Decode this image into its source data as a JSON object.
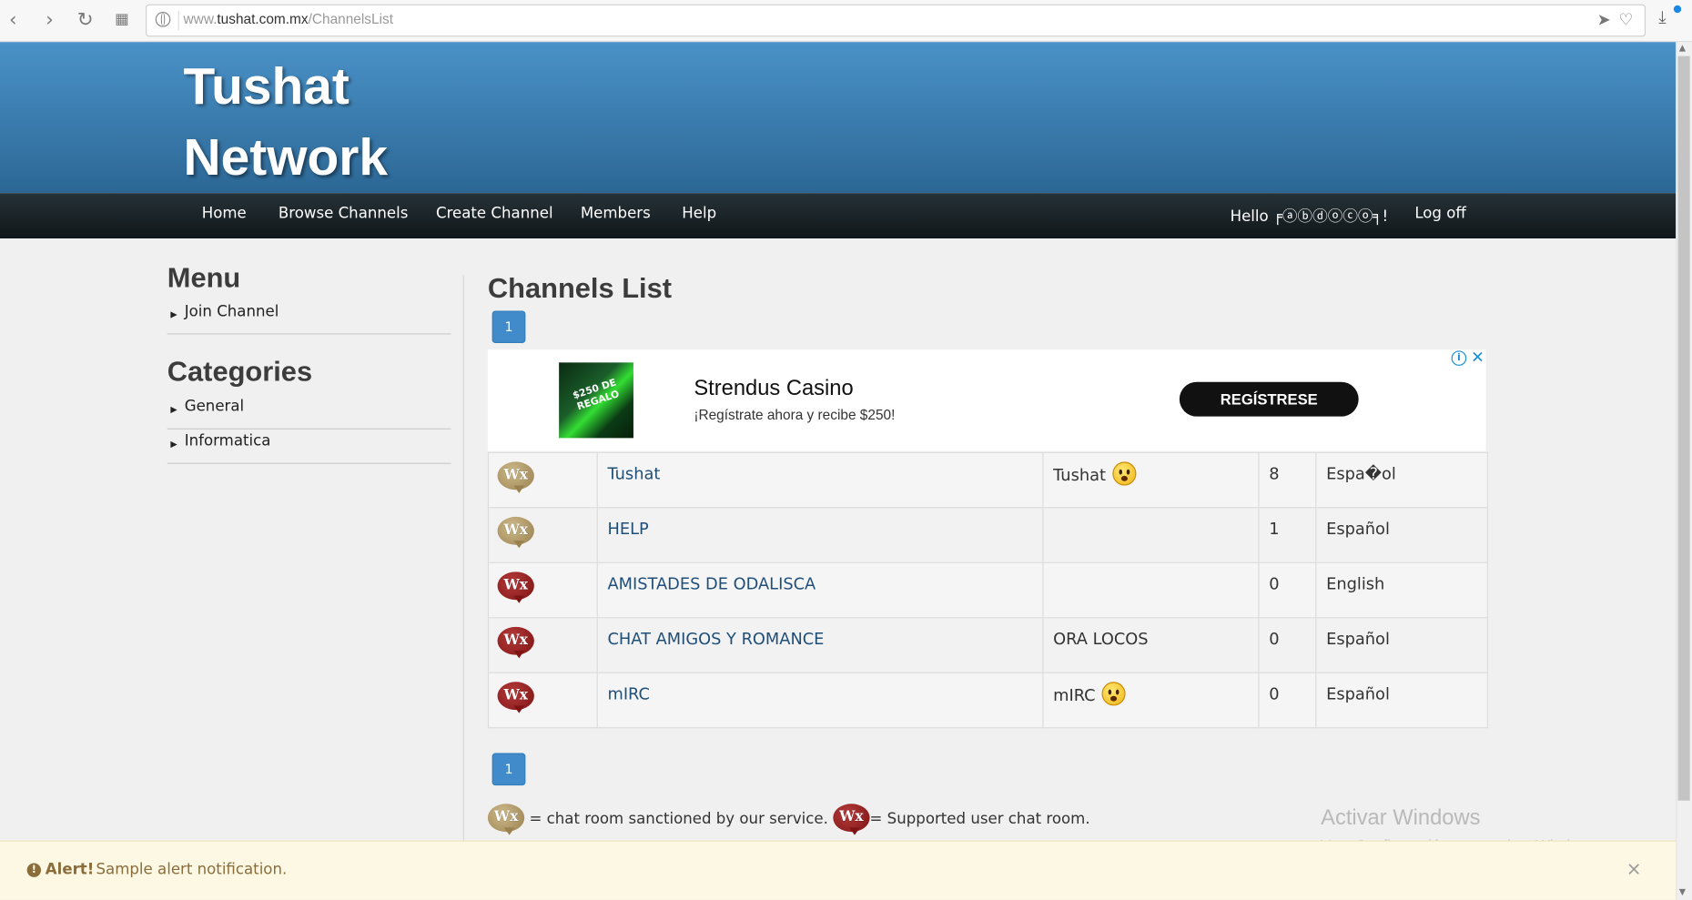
{
  "browser": {
    "url_prefix": "www.",
    "url_domain": "tushat.com.mx",
    "url_path": "/ChannelsList"
  },
  "site": {
    "title_line1": "Tushat",
    "title_line2": "Network"
  },
  "nav": {
    "home": "Home",
    "browse": "Browse Channels",
    "create": "Create Channel",
    "members": "Members",
    "help": "Help",
    "hello": "Hello ╒ⓐⓑⓓⓞⓒⓞ╕!",
    "logoff": "Log off"
  },
  "sidebar": {
    "menu_title": "Menu",
    "menu_items": [
      "Join Channel"
    ],
    "categories_title": "Categories",
    "categories": [
      "General",
      "Informatica"
    ]
  },
  "main": {
    "title": "Channels List",
    "page_number": "1"
  },
  "ad": {
    "image_text": "$250 DE REGALO",
    "name": "Strendus Casino",
    "description": "¡Regístrate ahora y recibe $250!",
    "cta": "REGÍSTRESE",
    "info": "i",
    "close": "✕"
  },
  "channels": [
    {
      "type": "sanctioned",
      "badge": "Wx",
      "name": "Tushat",
      "owner": "Tushat",
      "emoji": true,
      "users": "8",
      "language": "Espa�ol"
    },
    {
      "type": "sanctioned",
      "badge": "Wx",
      "name": "HELP",
      "owner": "",
      "emoji": false,
      "users": "1",
      "language": "Español"
    },
    {
      "type": "user",
      "badge": "Wx",
      "name": "AMISTADES DE ODALISCA",
      "owner": "",
      "emoji": false,
      "users": "0",
      "language": "English"
    },
    {
      "type": "user",
      "badge": "Wx",
      "name": "CHAT AMIGOS Y ROMANCE",
      "owner": "ORA LOCOS",
      "emoji": false,
      "users": "0",
      "language": "Español"
    },
    {
      "type": "user",
      "badge": "Wx",
      "name": "mIRC",
      "owner": "mIRC",
      "emoji": true,
      "users": "0",
      "language": "Español"
    }
  ],
  "legend": {
    "sanctioned_text": "= chat room sanctioned by our service.",
    "user_text": "= Supported user chat room."
  },
  "watermark": {
    "line1": "Activar Windows",
    "line2": "Ve a Configuración para activar Windows."
  },
  "alert": {
    "icon": "!",
    "title": "Alert!",
    "message": "Sample alert notification.",
    "close": "×"
  },
  "colors": {
    "header_top": "#4a92c8",
    "header_bottom": "#2c6795",
    "navbar": "#1a2226",
    "pager": "#428bca",
    "link": "#1f4e79",
    "alert_bg": "#fcf8e3",
    "alert_text": "#8a6d3b"
  },
  "icons": {
    "back": "chevron-left-icon",
    "forward": "chevron-right-icon",
    "reload": "reload-icon",
    "grid": "grid-icon",
    "globe": "globe-icon",
    "send": "send-icon",
    "favorite": "heart-icon",
    "download": "download-icon"
  }
}
